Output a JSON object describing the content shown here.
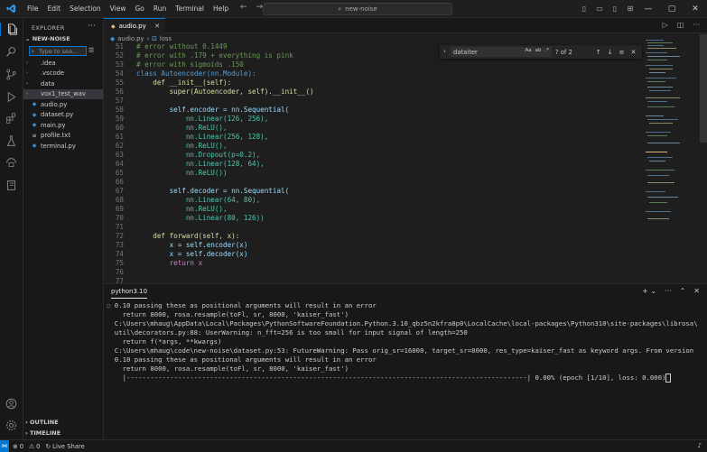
{
  "titlebar": {
    "menu": [
      "File",
      "Edit",
      "Selection",
      "View",
      "Go",
      "Run",
      "Terminal",
      "Help"
    ],
    "search": "new-noise"
  },
  "sidebar": {
    "title": "EXPLORER",
    "section": "NEW-NOISE",
    "search_placeholder": "Type to sea...",
    "items": [
      {
        "label": ".idea",
        "type": "folder"
      },
      {
        "label": ".vscode",
        "type": "folder"
      },
      {
        "label": "data",
        "type": "folder"
      },
      {
        "label": "vox1_test_wav",
        "type": "folder"
      },
      {
        "label": "audio.py",
        "type": "py"
      },
      {
        "label": "dataset.py",
        "type": "py"
      },
      {
        "label": "main.py",
        "type": "py"
      },
      {
        "label": "profile.txt",
        "type": "txt"
      },
      {
        "label": "terminal.py",
        "type": "py"
      }
    ],
    "outline": "OUTLINE",
    "timeline": "TIMELINE"
  },
  "editor": {
    "tab": "audio.py",
    "breadcrumb": [
      "audio.py",
      "loss"
    ],
    "find": {
      "query": "dataiter",
      "aa": "Aa",
      "ab": "ab",
      "regex": ".*",
      "count": "? of 2"
    },
    "lines": [
      {
        "n": "51",
        "text": "# error without 0.1449"
      },
      {
        "n": "52",
        "text": "# error with .179 + everything is pink"
      },
      {
        "n": "53",
        "text": "# error with sigmoids .150"
      },
      {
        "n": "54",
        "text": "class Autoencoder(nn.Module):"
      },
      {
        "n": "55",
        "text": "    def __init__(self):"
      },
      {
        "n": "56",
        "text": "        super(Autoencoder, self).__init__()"
      },
      {
        "n": "57",
        "text": ""
      },
      {
        "n": "58",
        "text": "        self.encoder = nn.Sequential("
      },
      {
        "n": "59",
        "text": "            nn.Linear(126, 256),"
      },
      {
        "n": "60",
        "text": "            nn.ReLU(),"
      },
      {
        "n": "61",
        "text": "            nn.Linear(256, 128),"
      },
      {
        "n": "62",
        "text": "            nn.ReLU(),"
      },
      {
        "n": "63",
        "text": "            nn.Dropout(p=0.2),"
      },
      {
        "n": "64",
        "text": "            nn.Linear(128, 64),"
      },
      {
        "n": "65",
        "text": "            nn.ReLU())"
      },
      {
        "n": "66",
        "text": ""
      },
      {
        "n": "67",
        "text": "        self.decoder = nn.Sequential("
      },
      {
        "n": "68",
        "text": "            nn.Linear(64, 80),"
      },
      {
        "n": "69",
        "text": "            nn.ReLU(),"
      },
      {
        "n": "70",
        "text": "            nn.Linear(80, 126))"
      },
      {
        "n": "71",
        "text": ""
      },
      {
        "n": "72",
        "text": "    def forward(self, x):"
      },
      {
        "n": "73",
        "text": "        x = self.encoder(x)"
      },
      {
        "n": "74",
        "text": "        x = self.decoder(x)"
      },
      {
        "n": "75",
        "text": "        return x"
      },
      {
        "n": "76",
        "text": ""
      },
      {
        "n": "77",
        "text": ""
      }
    ]
  },
  "panel": {
    "tab": "python3.10",
    "lines": [
      "0.10 passing these as positional arguments will result in an error",
      "  return 8000, rosa.resample(toFl, sr, 8000, 'kaiser_fast')",
      "C:\\Users\\mhaug\\AppData\\Local\\Packages\\PythonSoftwareFoundation.Python.3.10_qbz5n2kfra8p0\\LocalCache\\local-packages\\Python310\\site-packages\\librosa\\",
      "util\\decorators.py:88: UserWarning: n_fft=256 is too small for input signal of length=250",
      "  return f(*args, **kwargs)",
      "C:\\Users\\mhaug\\code\\new-noise\\dataset.py:53: FutureWarning: Pass orig_sr=16000, target_sr=8000, res_type=kaiser_fast as keyword args. From version",
      "0.10 passing these as positional arguments will result in an error",
      "  return 8000, rosa.resample(toFl, sr, 8000, 'kaiser_fast')",
      "  |-----------------------------------------------------------------------------------------------------| 0.00% (epoch [1/10], loss: 0.000)"
    ]
  },
  "statusbar": {
    "errors": "0",
    "warnings": "0",
    "live_share": "Live Share"
  },
  "colors": {
    "accent": "#0078d4",
    "background": "#1e1e1e",
    "sidebar": "#181818"
  }
}
